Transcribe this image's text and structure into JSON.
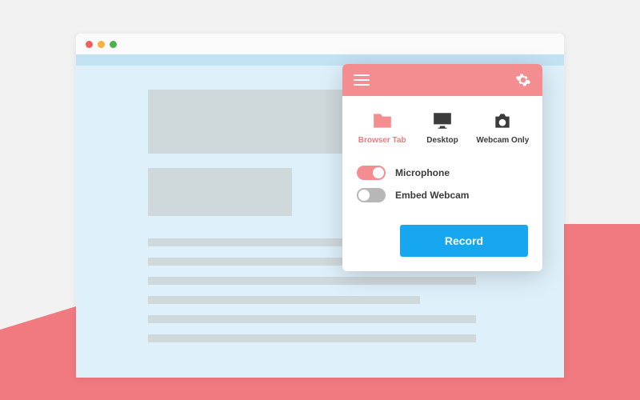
{
  "colors": {
    "accent": "#f48d8f",
    "accent_wave": "#f07a7f",
    "record": "#17a7f0",
    "dark": "#3b3b3b",
    "toggle_off": "#b7b7b7"
  },
  "popup": {
    "sources": {
      "browser_tab": {
        "label": "Browser Tab",
        "active": true
      },
      "desktop": {
        "label": "Desktop",
        "active": false
      },
      "webcam_only": {
        "label": "Webcam Only",
        "active": false
      }
    },
    "toggles": {
      "microphone": {
        "label": "Microphone",
        "on": true
      },
      "embed_webcam": {
        "label": "Embed Webcam",
        "on": false
      }
    },
    "record_label": "Record"
  }
}
